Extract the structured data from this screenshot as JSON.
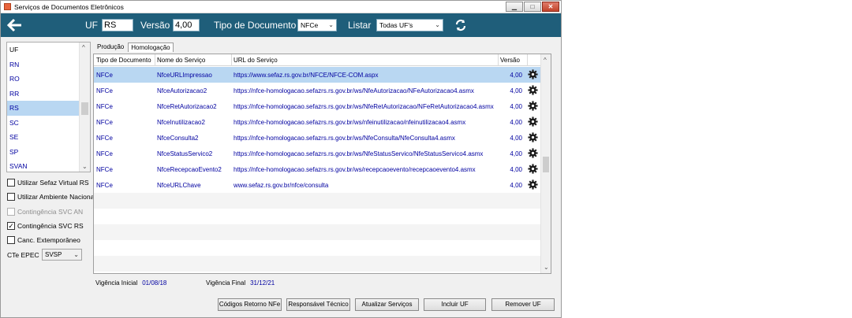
{
  "window": {
    "title": "Serviços de Documentos Eletrônicos"
  },
  "toolbar": {
    "uf_label": "UF",
    "uf_value": "RS",
    "versao_label": "Versão",
    "versao_value": "4,00",
    "tipo_label": "Tipo de Documento",
    "tipo_value": "NFCe",
    "listar_label": "Listar",
    "listar_value": "Todas UF's"
  },
  "uf_list": {
    "header": "UF",
    "items": [
      "RN",
      "RO",
      "RR",
      "RS",
      "SC",
      "SE",
      "SP",
      "SVAN"
    ],
    "selected": "RS"
  },
  "options": {
    "sefaz_virtual": {
      "label": "Utilizar Sefaz Virtual RS",
      "checked": false
    },
    "ambiente_nacional": {
      "label": "Utilizar Ambiente Nacional",
      "checked": false
    },
    "svc_an": {
      "label": "Contingência SVC AN",
      "checked": false,
      "disabled": true
    },
    "svc_rs": {
      "label": "Contingência SVC RS",
      "checked": true
    },
    "canc_extemporaneo": {
      "label": "Canc. Extemporâneo",
      "checked": false
    },
    "cte_epec_label": "CTe EPEC",
    "cte_epec_value": "SVSP"
  },
  "tabs": [
    "Produção",
    "Homologação"
  ],
  "active_tab": "Homologação",
  "grid": {
    "columns": [
      "Tipo de Documento",
      "Nome do Serviço",
      "URL do Serviço",
      "Versão"
    ],
    "rows": [
      {
        "tipo": "NFCe",
        "nome": "NfceURLImpressao",
        "url": "https://www.sefaz.rs.gov.br/NFCE/NFCE-COM.aspx",
        "versao": "4,00"
      },
      {
        "tipo": "NFCe",
        "nome": "NfceAutorizacao2",
        "url": "https://nfce-homologacao.sefazrs.rs.gov.br/ws/NfeAutorizacao/NFeAutorizacao4.asmx",
        "versao": "4,00"
      },
      {
        "tipo": "NFCe",
        "nome": "NfceRetAutorizacao2",
        "url": "https://nfce-homologacao.sefazrs.rs.gov.br/ws/NfeRetAutorizacao/NFeRetAutorizacao4.asmx",
        "versao": "4,00"
      },
      {
        "tipo": "NFCe",
        "nome": "NfceInutilizacao2",
        "url": "https://nfce-homologacao.sefazrs.rs.gov.br/ws/nfeinutilizacao/nfeinutilizacao4.asmx",
        "versao": "4,00"
      },
      {
        "tipo": "NFCe",
        "nome": "NfceConsulta2",
        "url": "https://nfce-homologacao.sefazrs.rs.gov.br/ws/NfeConsulta/NfeConsulta4.asmx",
        "versao": "4,00"
      },
      {
        "tipo": "NFCe",
        "nome": "NfceStatusServico2",
        "url": "https://nfce-homologacao.sefazrs.rs.gov.br/ws/NfeStatusServico/NfeStatusServico4.asmx",
        "versao": "4,00"
      },
      {
        "tipo": "NFCe",
        "nome": "NfceRecepcaoEvento2",
        "url": "https://nfce-homologacao.sefazrs.rs.gov.br/ws/recepcaoevento/recepcaoevento4.asmx",
        "versao": "4,00"
      },
      {
        "tipo": "NFCe",
        "nome": "NfceURLChave",
        "url": "www.sefaz.rs.gov.br/nfce/consulta",
        "versao": "4,00"
      }
    ],
    "selected_row": 0
  },
  "vigencia": {
    "inicial_label": "Vigência Inicial",
    "inicial_value": "01/08/18",
    "final_label": "Vigência Final",
    "final_value": "31/12/21"
  },
  "buttons": {
    "codigos_retorno": "Códigos Retorno NFe",
    "responsavel_tecnico": "Responsável Técnico",
    "atualizar_servicos": "Atualizar Serviços",
    "incluir_uf": "Incluir UF",
    "remover_uf": "Remover UF"
  },
  "colors": {
    "toolbar_bg": "#1f5e7a",
    "selection": "#b9d7f2",
    "link_text": "#0000a0"
  }
}
